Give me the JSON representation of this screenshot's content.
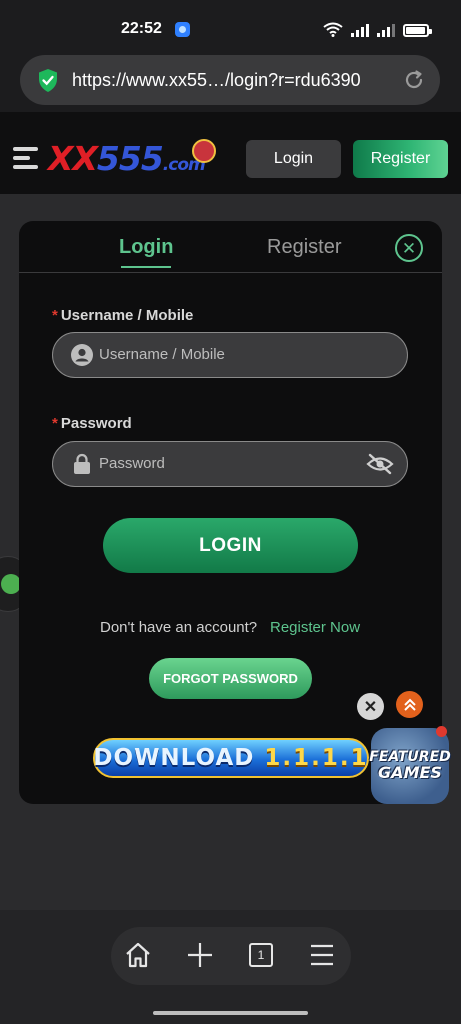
{
  "status_bar": {
    "time": "22:52"
  },
  "browser": {
    "url": "https://www.xx55…/login?r=rdu6390"
  },
  "site_header": {
    "logo_x": "XX",
    "logo_num": "555",
    "logo_com": ".com",
    "login_label": "Login",
    "register_label": "Register"
  },
  "modal": {
    "tabs": {
      "login": "Login",
      "register": "Register"
    },
    "username": {
      "label": "Username / Mobile",
      "placeholder": "Username / Mobile",
      "required_mark": "*"
    },
    "password": {
      "label": "Password",
      "placeholder": "Password",
      "required_mark": "*"
    },
    "login_button": "LOGIN",
    "no_account_text": "Don't have an account?",
    "register_now": "Register Now",
    "forgot_password": "FORGOT PASSWORD",
    "download": {
      "word": "DOWNLOAD",
      "version": "1.1.1.1"
    }
  },
  "featured": {
    "line1": "FEATURED",
    "line2": "GAMES"
  },
  "bottom_nav": {
    "tab_count": "1"
  },
  "colors": {
    "accent_green": "#5ec48e",
    "required_red": "#e0392e",
    "logo_red": "#e01f26",
    "logo_blue": "#3456d8"
  }
}
